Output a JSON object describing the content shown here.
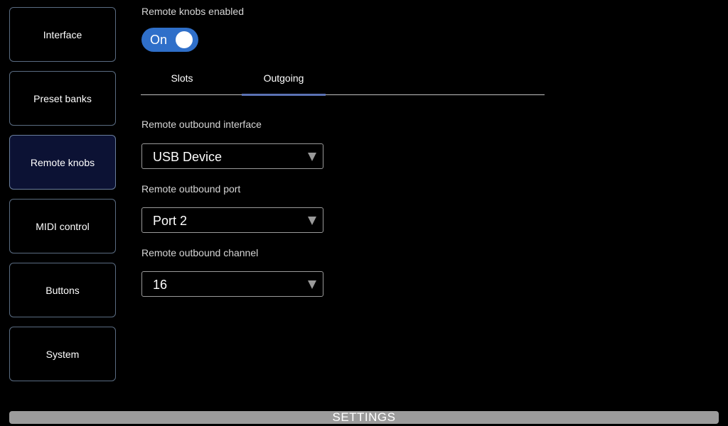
{
  "sidebar": {
    "items": [
      {
        "label": "Interface"
      },
      {
        "label": "Preset banks"
      },
      {
        "label": "Remote knobs",
        "active": true
      },
      {
        "label": "MIDI control"
      },
      {
        "label": "Buttons"
      },
      {
        "label": "System"
      }
    ]
  },
  "remote_knobs": {
    "enabled_label": "Remote knobs enabled",
    "toggle_state": "On",
    "toggle_color": "#2f6fc9"
  },
  "tabs": [
    {
      "label": "Slots"
    },
    {
      "label": "Outgoing",
      "active": true
    }
  ],
  "outgoing": {
    "interface_label": "Remote outbound interface",
    "interface_value": "USB Device",
    "port_label": "Remote outbound port",
    "port_value": "Port 2",
    "channel_label": "Remote outbound channel",
    "channel_value": "16"
  },
  "footer": {
    "title": "SETTINGS"
  },
  "icons": {
    "dropdown": "chevron-down-icon"
  }
}
